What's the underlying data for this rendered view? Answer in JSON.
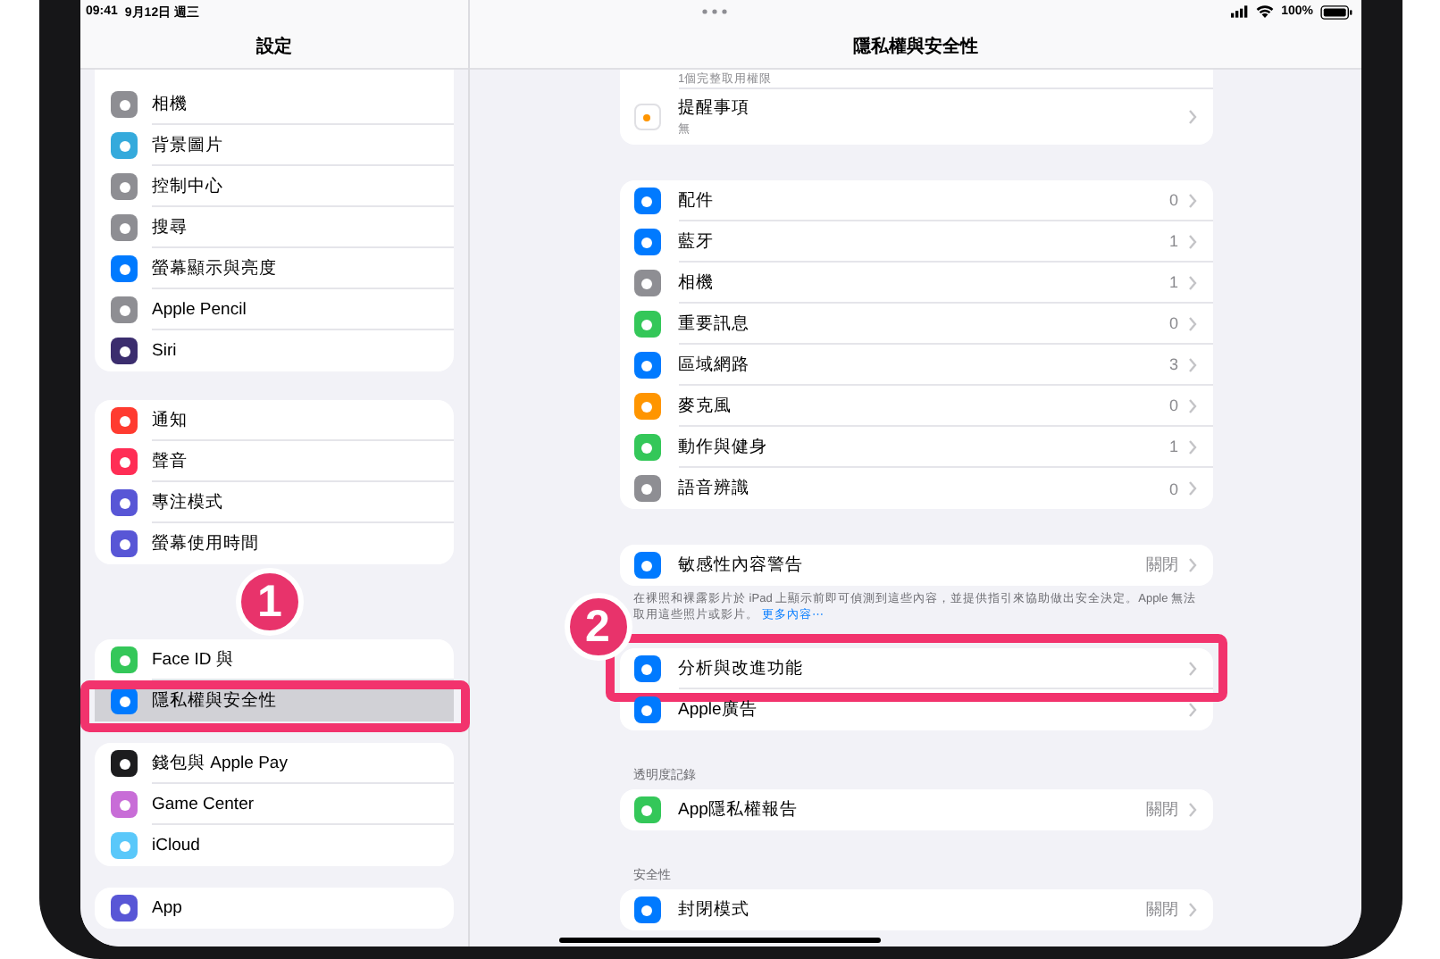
{
  "status_bar": {
    "time": "09:41",
    "date": "9月12日 週三",
    "battery": "100%"
  },
  "sidebar": {
    "title": "設定",
    "groups": [
      [
        {
          "label": "相機",
          "color": "#8e8e93",
          "selected": false
        },
        {
          "label": "背景圖片",
          "color": "#35aadc",
          "selected": false
        },
        {
          "label": "控制中心",
          "color": "#8e8e93",
          "selected": false
        },
        {
          "label": "搜尋",
          "color": "#8e8e93",
          "selected": false
        },
        {
          "label": "螢幕顯示與亮度",
          "color": "#007aff",
          "selected": false
        },
        {
          "label": "Apple Pencil",
          "color": "#8e8e93",
          "selected": false
        },
        {
          "label": "Siri",
          "color": "#3b2d6e",
          "selected": false
        }
      ],
      [
        {
          "label": "通知",
          "color": "#ff3b30",
          "selected": false
        },
        {
          "label": "聲音",
          "color": "#ff2d55",
          "selected": false
        },
        {
          "label": "專注模式",
          "color": "#5856d6",
          "selected": false
        },
        {
          "label": "螢幕使用時間",
          "color": "#5856d6",
          "selected": false
        }
      ],
      [
        {
          "label": "Face ID 與",
          "color": "#34c759",
          "selected": false
        },
        {
          "label": "隱私權與安全性",
          "color": "#007aff",
          "selected": true,
          "annotation": "1"
        }
      ],
      [
        {
          "label": "錢包與 Apple Pay",
          "color": "#1c1c1e",
          "selected": false
        },
        {
          "label": "Game Center",
          "color": "#c86dd7",
          "selected": false
        },
        {
          "label": "iCloud",
          "color": "#5ac8fa",
          "selected": false
        }
      ],
      [
        {
          "label": "App",
          "color": "#5856d6",
          "selected": false
        }
      ]
    ]
  },
  "detail": {
    "title": "隱私權與安全性",
    "sections": [
      {
        "rows": [
          {
            "subtitle": "1個完整取用權限"
          },
          {
            "title": "提醒事項",
            "subtitle": "無",
            "color": "#ffffff"
          }
        ]
      },
      {
        "rows": [
          {
            "title": "配件",
            "value": "0",
            "color": "#007aff"
          },
          {
            "title": "藍牙",
            "value": "1",
            "color": "#007aff"
          },
          {
            "title": "相機",
            "value": "1",
            "color": "#8e8e93"
          },
          {
            "title": "重要訊息",
            "value": "0",
            "color": "#34c759"
          },
          {
            "title": "區域網路",
            "value": "3",
            "color": "#007aff"
          },
          {
            "title": "麥克風",
            "value": "0",
            "color": "#ff9500"
          },
          {
            "title": "動作與健身",
            "value": "1",
            "color": "#34c759"
          },
          {
            "title": "語音辨識",
            "value": "0",
            "color": "#8e8e93"
          }
        ]
      },
      {
        "rows": [
          {
            "title": "敏感性內容警告",
            "value": "關閉",
            "color": "#007aff"
          }
        ],
        "footer": "在裸照和裸露影片於 iPad 上顯示前即可偵測到這些內容，並提供指引來協助做出安全決定。Apple 無法取用這些照片或影片。",
        "footer_link": "更多內容⋯"
      },
      {
        "rows": [
          {
            "title": "分析與改進功能",
            "color": "#007aff",
            "annotation": "2"
          },
          {
            "title": "Apple廣告",
            "color": "#007aff"
          }
        ]
      },
      {
        "header": "透明度記錄",
        "rows": [
          {
            "title": "App隱私權報告",
            "value": "關閉",
            "color": "#34c759"
          }
        ]
      },
      {
        "header": "安全性",
        "rows": [
          {
            "title": "封閉模式",
            "value": "關閉",
            "color": "#007aff"
          }
        ]
      }
    ]
  }
}
